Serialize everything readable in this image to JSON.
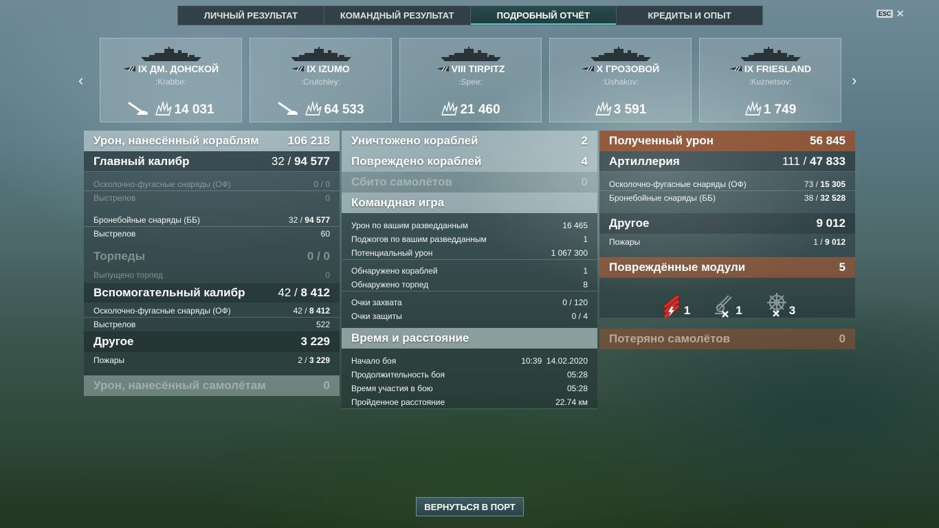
{
  "tabs": [
    {
      "label": "ЛИЧНЫЙ РЕЗУЛЬТАТ"
    },
    {
      "label": "КОМАНДНЫЙ РЕЗУЛЬТАТ"
    },
    {
      "label": "ПОДРОБНЫЙ ОТЧЁТ",
      "active": true
    },
    {
      "label": "КРЕДИТЫ И ОПЫТ"
    }
  ],
  "esc": {
    "key": "ESC",
    "close": "✕"
  },
  "nav": {
    "prev": "‹",
    "next": "›"
  },
  "ships": [
    {
      "name": "IX ДМ. ДОНСКОЙ",
      "commander": ":Krabbe:",
      "value": "14 031",
      "torpedo_icon": true
    },
    {
      "name": "IX IZUMO",
      "commander": ":Crutchley:",
      "value": "64 533",
      "torpedo_icon": true
    },
    {
      "name": "VIII TIRPITZ",
      "commander": ":Spee:",
      "value": "21 460",
      "torpedo_icon": false
    },
    {
      "name": "X ГРОЗОВОЙ",
      "commander": ":Ushakov:",
      "value": "3 591",
      "torpedo_icon": false
    },
    {
      "name": "IX FRIESLAND",
      "commander": ":Kuznetsov:",
      "value": "1 749",
      "torpedo_icon": false
    }
  ],
  "left": {
    "damage_ships": {
      "label": "Урон, нанесённый кораблям",
      "value": "106 218"
    },
    "main_battery": {
      "label": "Главный калибр",
      "hits": "32",
      "sep": " / ",
      "dmg": "94 577"
    },
    "he": {
      "label": "Осколочно-фугасные снаряды (ОФ)",
      "hits": "0",
      "sep": " / ",
      "dmg": "0"
    },
    "he_shots": {
      "label": "Выстрелов",
      "value": "0"
    },
    "ap": {
      "label": "Бронебойные снаряды (ББ)",
      "hits": "32",
      "sep": " / ",
      "dmg": "94 577"
    },
    "ap_shots": {
      "label": "Выстрелов",
      "value": "60"
    },
    "torpedoes": {
      "label": "Торпеды",
      "value": "0 / 0"
    },
    "torp_launched": {
      "label": "Выпущено торпед",
      "value": "0"
    },
    "secondary": {
      "label": "Вспомогательный калибр",
      "hits": "42",
      "sep": " / ",
      "dmg": "8 412"
    },
    "sec_he": {
      "label": "Осколочно-фугасные снаряды (ОФ)",
      "hits": "42",
      "sep": " / ",
      "dmg": "8 412"
    },
    "sec_shots": {
      "label": "Выстрелов",
      "value": "522"
    },
    "other": {
      "label": "Другое",
      "value": "3 229"
    },
    "fires": {
      "label": "Пожары",
      "hits": "2",
      "sep": " / ",
      "dmg": "3 229"
    },
    "damage_planes": {
      "label": "Урон, нанесённый самолётам",
      "value": "0"
    }
  },
  "mid": {
    "destroyed": {
      "label": "Уничтожено кораблей",
      "value": "2"
    },
    "damaged": {
      "label": "Повреждено кораблей",
      "value": "4"
    },
    "planes_shot": {
      "label": "Сбито самолётов",
      "value": "0"
    },
    "team_play": {
      "label": "Командная игра"
    },
    "spot_dmg": {
      "label": "Урон по вашим разведданным",
      "value": "16 465"
    },
    "spot_fires": {
      "label": "Поджогов по вашим разведданным",
      "value": "1"
    },
    "potential": {
      "label": "Потенциальный урон",
      "value": "1 067 300"
    },
    "spotted_ships": {
      "label": "Обнаружено кораблей",
      "value": "1"
    },
    "spotted_torps": {
      "label": "Обнаружено торпед",
      "value": "8"
    },
    "capture": {
      "label": "Очки захвата",
      "value": "0 / 120"
    },
    "defense": {
      "label": "Очки защиты",
      "value": "0 / 4"
    },
    "time_title": {
      "label": "Время и расстояние"
    },
    "start": {
      "label": "Начало боя",
      "value": "10:39  14.02.2020"
    },
    "duration": {
      "label": "Продолжительность боя",
      "value": "05:28"
    },
    "participation": {
      "label": "Время участия в бою",
      "value": "05:28"
    },
    "distance": {
      "label": "Пройденное расстояние",
      "value": "22.74 км"
    }
  },
  "right": {
    "received": {
      "label": "Полученный урон",
      "value": "56 845"
    },
    "artillery": {
      "label": "Артиллерия",
      "hits": "111",
      "sep": " / ",
      "dmg": "47 833"
    },
    "he": {
      "label": "Осколочно-фугасные снаряды (ОФ)",
      "hits": "73",
      "sep": " / ",
      "dmg": "15 305"
    },
    "ap": {
      "label": "Бронебойные снаряды (ББ)",
      "hits": "38",
      "sep": " / ",
      "dmg": "32 528"
    },
    "other": {
      "label": "Другое",
      "value": "9 012"
    },
    "fires": {
      "label": "Пожары",
      "hits": "1",
      "sep": " / ",
      "dmg": "9 012"
    },
    "modules": {
      "label": "Повреждённые модули",
      "value": "5"
    },
    "module_icons": [
      {
        "icon": "torpedo-tubes-icon",
        "count": "1"
      },
      {
        "icon": "aa-gun-icon",
        "count": "1"
      },
      {
        "icon": "steering-gear-icon",
        "count": "3"
      }
    ],
    "planes_lost": {
      "label": "Потеряно самолётов",
      "value": "0"
    }
  },
  "footer": {
    "return_label": "ВЕРНУТЬСЯ В ПОРТ"
  },
  "colors": {
    "accent": "#5ccac4",
    "received": "#96502d"
  }
}
